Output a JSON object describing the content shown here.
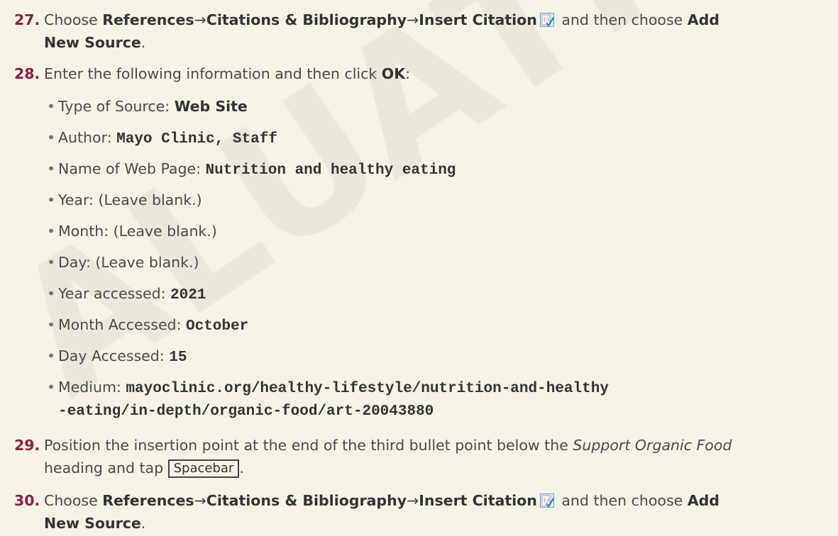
{
  "watermark": "ALUATIO",
  "steps": {
    "s27": {
      "num": "27.",
      "pre": "Choose ",
      "b1": "References",
      "arrow1": "→",
      "b2": "Citations & Bibliography",
      "arrow2": "→",
      "b3": "Insert Citation",
      "mid": " and then choose ",
      "b4a": "Add",
      "b4b": "New Source",
      "end": "."
    },
    "s28": {
      "num": "28.",
      "pre": "Enter the following information and then click ",
      "b1": "OK",
      "end": ":"
    },
    "s29": {
      "num": "29.",
      "line1_pre": "Position the insertion point at the end of the third bullet point below the ",
      "line1_italic": "Support Organic Food",
      "line2_pre": "heading and tap ",
      "key": "Spacebar",
      "end": "."
    },
    "s30": {
      "num": "30.",
      "pre": "Choose ",
      "b1": "References",
      "arrow1": "→",
      "b2": "Citations & Bibliography",
      "arrow2": "→",
      "b3": "Insert Citation",
      "mid": " and then choose ",
      "b4a": "Add",
      "b4b": "New Source",
      "end": "."
    }
  },
  "bullets": [
    {
      "label": "Type of Source: ",
      "value": "Web Site",
      "style": "bold"
    },
    {
      "label": "Author: ",
      "value": "Mayo Clinic, Staff",
      "style": "mono"
    },
    {
      "label": "Name of Web Page: ",
      "value": "Nutrition and healthy eating",
      "style": "mono"
    },
    {
      "label": "Year: (Leave blank.)",
      "value": "",
      "style": "plain"
    },
    {
      "label": "Month: (Leave blank.)",
      "value": "",
      "style": "plain"
    },
    {
      "label": "Day: (Leave blank.)",
      "value": "",
      "style": "plain"
    },
    {
      "label": "Year accessed: ",
      "value": "2021",
      "style": "mono"
    },
    {
      "label": "Month Accessed: ",
      "value": "October",
      "style": "mono"
    },
    {
      "label": "Day Accessed: ",
      "value": "15",
      "style": "mono"
    },
    {
      "label": "Medium: ",
      "value": "mayoclinic.org/healthy-lifestyle/nutrition-and-healthy",
      "style": "mono"
    }
  ],
  "medium_cont": "-eating/in-depth/organic-food/art-20043880",
  "bullet_char": "•",
  "icon": "insert-citation-icon"
}
